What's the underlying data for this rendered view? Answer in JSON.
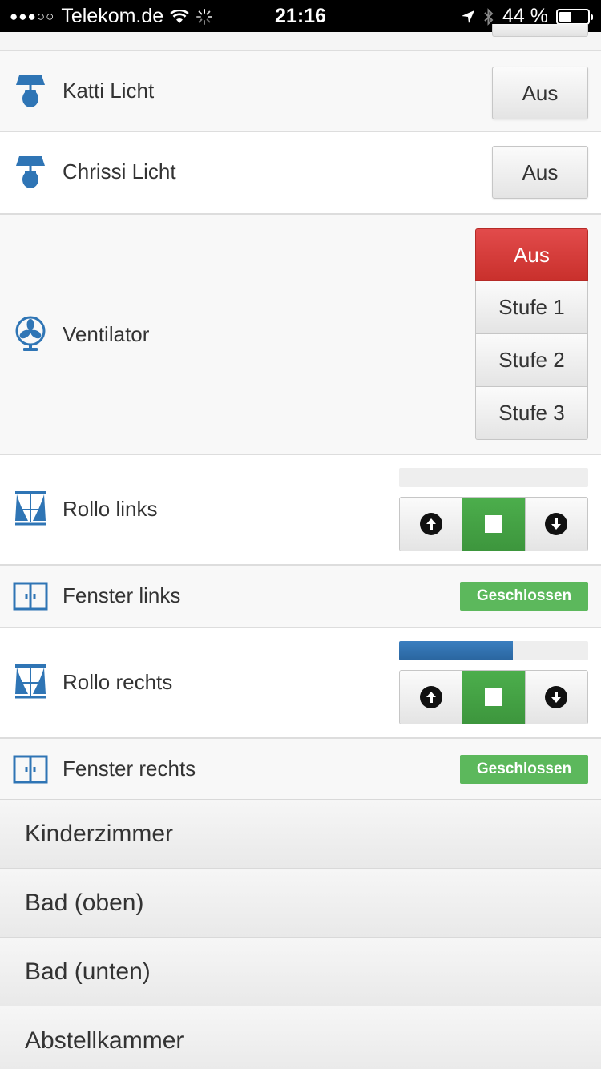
{
  "status_bar": {
    "signal": "●●●○○",
    "carrier": "Telekom.de",
    "time": "21:16",
    "battery_text": "44 %",
    "battery_level": 0.44
  },
  "devices": {
    "katti": {
      "label": "Katti Licht",
      "button": "Aus",
      "icon": "lamp-icon"
    },
    "chrissi": {
      "label": "Chrissi Licht",
      "button": "Aus",
      "icon": "lamp-icon"
    },
    "ventilator": {
      "label": "Ventilator",
      "icon": "fan-icon",
      "options": [
        "Aus",
        "Stufe 1",
        "Stufe 2",
        "Stufe 3"
      ],
      "active": "Aus"
    },
    "rollo_links": {
      "label": "Rollo links",
      "position": 0.0,
      "icon": "blind-icon"
    },
    "fenster_links": {
      "label": "Fenster links",
      "status": "Geschlossen",
      "icon": "window-icon"
    },
    "rollo_rechts": {
      "label": "Rollo rechts",
      "position": 0.6,
      "icon": "blind-icon"
    },
    "fenster_rechts": {
      "label": "Fenster rechts",
      "status": "Geschlossen",
      "icon": "window-icon"
    }
  },
  "categories": [
    "Kinderzimmer",
    "Bad (oben)",
    "Bad (unten)",
    "Abstellkammer"
  ],
  "colors": {
    "accent_blue": "#2f75b5",
    "active_red": "#d9534f",
    "active_green": "#449d44",
    "badge_green": "#5cb85c"
  }
}
